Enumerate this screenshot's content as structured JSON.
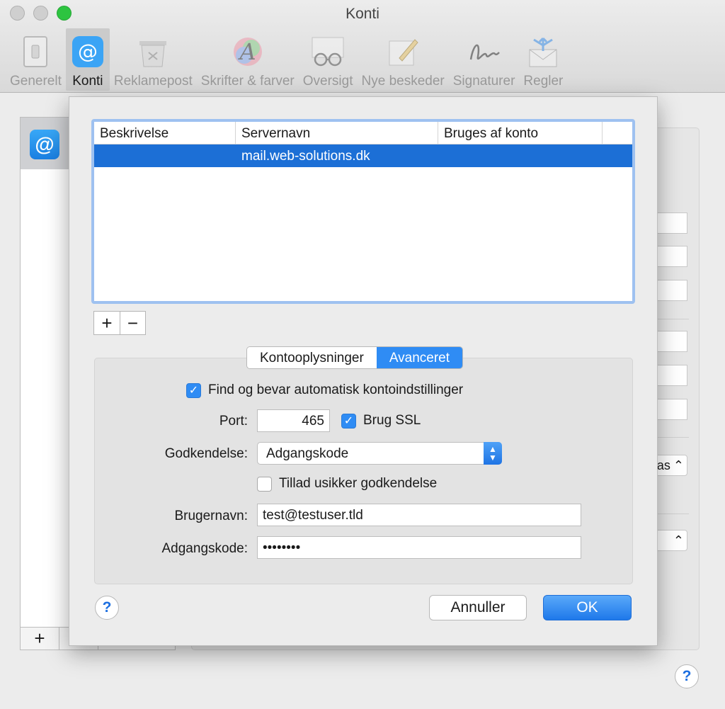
{
  "window": {
    "title": "Konti"
  },
  "toolbar": {
    "items": [
      {
        "label": "Generelt",
        "icon": "switch-icon"
      },
      {
        "label": "Konti",
        "icon": "at-icon"
      },
      {
        "label": "Reklamepost",
        "icon": "trash-icon"
      },
      {
        "label": "Skrifter & farver",
        "icon": "font-color-icon"
      },
      {
        "label": "Oversigt",
        "icon": "glasses-icon"
      },
      {
        "label": "Nye beskeder",
        "icon": "pencil-note-icon"
      },
      {
        "label": "Signaturer",
        "icon": "signature-icon"
      },
      {
        "label": "Regler",
        "icon": "envelope-arrows-icon"
      }
    ],
    "active": "Konti"
  },
  "background": {
    "select_partial_text": "as"
  },
  "sheet": {
    "table": {
      "columns": [
        "Beskrivelse",
        "Servernavn",
        "Bruges af konto"
      ],
      "rows": [
        {
          "description": "",
          "server": "mail.web-solutions.dk",
          "used_by": ""
        }
      ]
    },
    "add_label": "+",
    "remove_label": "−",
    "tabs": [
      "Kontooplysninger",
      "Avanceret"
    ],
    "selected_tab": "Avanceret",
    "auto_detect": {
      "label": "Find og bevar automatisk kontoindstillinger",
      "checked": true
    },
    "port": {
      "label": "Port:",
      "value": "465"
    },
    "ssl": {
      "label": "Brug SSL",
      "checked": true
    },
    "auth": {
      "label": "Godkendelse:",
      "value": "Adgangskode"
    },
    "insecure_auth": {
      "label": "Tillad usikker godkendelse",
      "checked": false
    },
    "username": {
      "label": "Brugernavn:",
      "value": "test@testuser.tld"
    },
    "password": {
      "label": "Adgangskode:",
      "value": "••••••••"
    },
    "help_label": "?",
    "cancel_label": "Annuller",
    "ok_label": "OK"
  },
  "colors": {
    "accent": "#2f8cf4",
    "selection": "#1c6fd6",
    "zoom_button": "#2dc440"
  }
}
